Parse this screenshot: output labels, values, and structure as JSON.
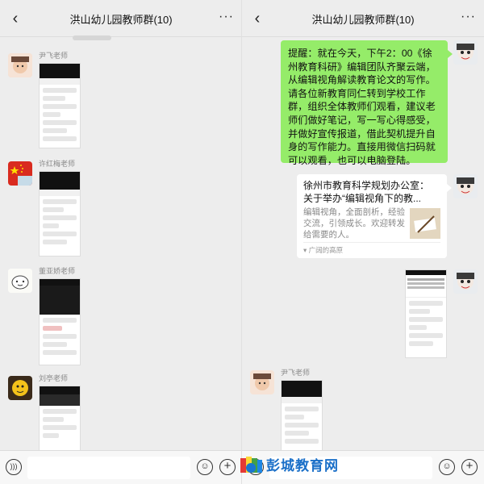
{
  "chat_title": "洪山幼儿园教师群(10)",
  "icons": {
    "back": "chevron-left-icon",
    "more": "more-dots-icon",
    "voice": "voice-icon",
    "emoji": "emoji-icon",
    "plus": "plus-icon"
  },
  "left": {
    "messages": [
      {
        "name": "尹飞老师"
      },
      {
        "name": "许红梅老师"
      },
      {
        "name": "董亚娇老师"
      },
      {
        "name": "刘亭老师"
      }
    ]
  },
  "right": {
    "reminder": "提醒：就在今天，下午2：00《徐州教育科研》编辑团队齐聚云端，从编辑视角解读教育论文的写作。请各位新教育同仁转到学校工作群，组织全体教师们观看，建议老师们做好笔记，写一写心得感受，并做好宣传报道，借此契机提升自身的写作能力。直接用微信扫码就可以观看，也可以电脑登陆。",
    "card": {
      "title_line1": "徐州市教育科学规划办公室：",
      "title_line2": "关于举办“编辑视角下的教...",
      "desc": "编辑视角，全面剖析，经验交流，引领成长。欢迎转发给需要的人。",
      "source": "广阔的高原"
    },
    "sender_name": "尹飞老师"
  },
  "watermark": "彭城教育网",
  "colors": {
    "bubble_green": "#95ec69",
    "background": "#ededed",
    "watermark_blue": "#1a6fc8"
  }
}
